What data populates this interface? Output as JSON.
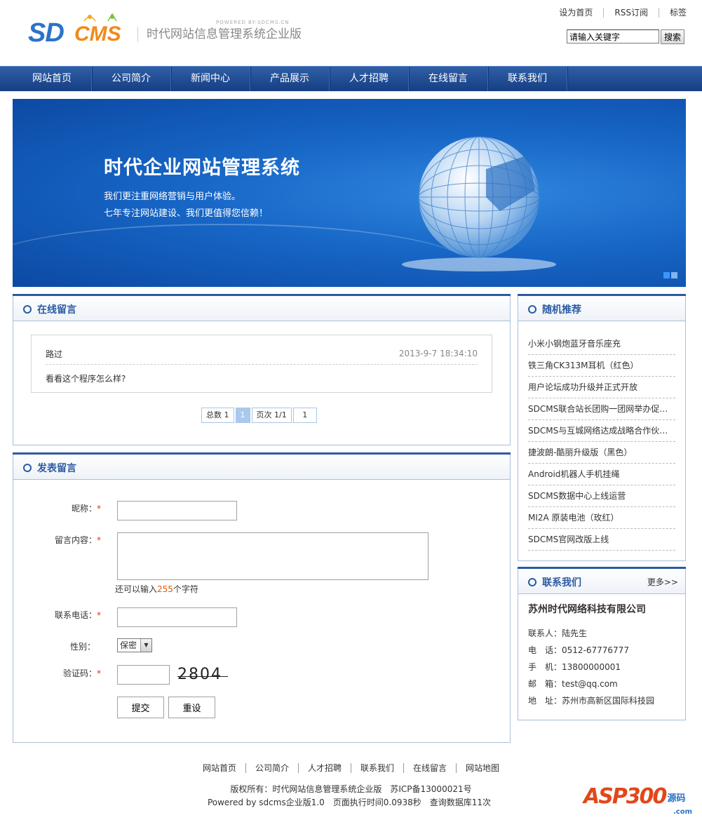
{
  "header": {
    "logo_sd": "SD",
    "logo_cms": "CMS",
    "powered": "POWERED BY:SDCMS.CN",
    "site_name": "时代网站信息管理系统企业版",
    "top_links": [
      "设为首页",
      "RSS订阅",
      "标签"
    ],
    "search_placeholder": "请输入关键字",
    "search_button": "搜索"
  },
  "nav": [
    "网站首页",
    "公司简介",
    "新闻中心",
    "产品展示",
    "人才招聘",
    "在线留言",
    "联系我们"
  ],
  "banner": {
    "title": "时代企业网站管理系统",
    "line1": "我们更注重网络营销与用户体验。",
    "line2": "七年专注网站建设、我们更值得您信赖！"
  },
  "messages_panel": {
    "title": "在线留言",
    "message": {
      "name": "路过",
      "time": "2013-9-7 18:34:10",
      "content": "看看这个程序怎么样?"
    },
    "pager": {
      "total": "总数 1",
      "current": "1",
      "pages": "页次 1/1",
      "jump": "1"
    }
  },
  "form_panel": {
    "title": "发表留言",
    "nickname_label": "昵称：",
    "content_label": "留言内容：",
    "hint_before": "还可以输入",
    "hint_count": "255",
    "hint_after": "个字符",
    "phone_label": "联系电话：",
    "gender_label": "性别：",
    "gender_value": "保密",
    "captcha_label": "验证码：",
    "captcha_text": "2804",
    "required_mark": "*",
    "submit": "提交",
    "reset": "重设"
  },
  "random_panel": {
    "title": "随机推荐",
    "items": [
      "小米小钢炮蓝牙音乐座充",
      "铁三角CK313M耳机（红色）",
      "用户论坛成功升级并正式开放",
      "SDCMS联合站长团购一团网举办促销...",
      "SDCMS与互城网络达成战略合作伙伴...",
      "捷波朗-酷丽升级版（黑色）",
      "Android机器人手机挂绳",
      "SDCMS数据中心上线运营",
      "MI2A 原装电池（玫红）",
      "SDCMS官网改版上线"
    ]
  },
  "contact_panel": {
    "title": "联系我们",
    "more": "更多>>",
    "company": "苏州时代网络科技有限公司",
    "rows": [
      "联系人：陆先生",
      "电　话：0512-67776777",
      "手　机：13800000001",
      "邮　箱：test@qq.com",
      "地　址：苏州市高新区国际科技园"
    ]
  },
  "footer": {
    "links": [
      "网站首页",
      "公司简介",
      "人才招聘",
      "联系我们",
      "在线留言",
      "网站地图"
    ],
    "copyright": "版权所有：时代网站信息管理系统企业版　苏ICP备13000021号",
    "powered": "Powered by sdcms企业版1.0　页面执行时间0.0938秒　查询数据库11次",
    "watermark": "ASP300",
    "watermark_small": "源码",
    "watermark_domain": ".com"
  }
}
